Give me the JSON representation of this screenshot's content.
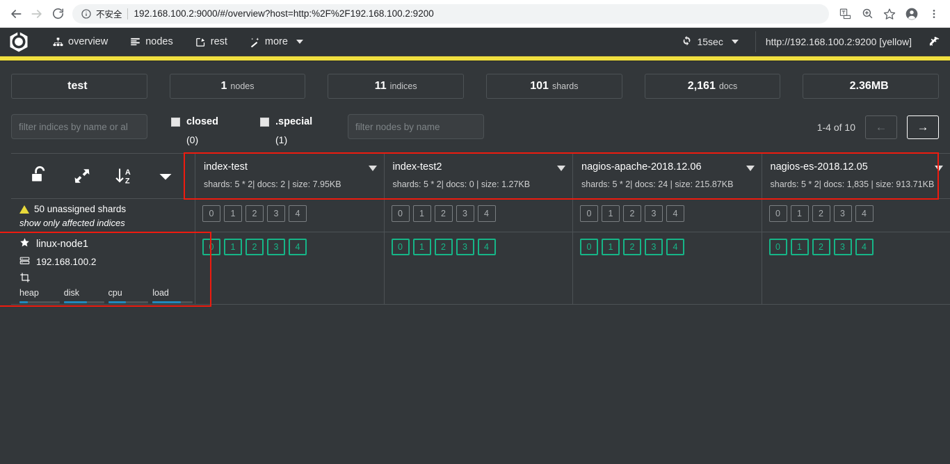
{
  "browser": {
    "back_icon": "back-arrow-icon",
    "forward_icon": "forward-arrow-icon",
    "reload_icon": "reload-icon",
    "security_label": "不安全",
    "url": "192.168.100.2:9000/#/overview?host=http:%2F%2F192.168.100.2:9200",
    "toolbar_icons": [
      "translate-icon",
      "zoom-icon",
      "bookmark-star-icon",
      "profile-avatar-icon",
      "chrome-menu-icon"
    ]
  },
  "app_header": {
    "logo": "cerebro-logo-icon",
    "nav": [
      {
        "label": "overview",
        "icon": "sitemap-icon"
      },
      {
        "label": "nodes",
        "icon": "list-icon"
      },
      {
        "label": "rest",
        "icon": "edit-square-icon"
      },
      {
        "label": "more",
        "icon": "magic-wand-icon",
        "has_caret": true
      }
    ],
    "refresh_interval": "15sec",
    "refresh_icon": "refresh-icon",
    "cluster_url": "http://192.168.100.2:9200 [yellow]",
    "disconnect_icon": "plug-icon",
    "accent_color": "#f0df3f"
  },
  "stats": [
    {
      "value": "test",
      "unit": ""
    },
    {
      "value": "1",
      "unit": "nodes"
    },
    {
      "value": "11",
      "unit": "indices"
    },
    {
      "value": "101",
      "unit": "shards"
    },
    {
      "value": "2,161",
      "unit": "docs"
    },
    {
      "value": "2.36MB",
      "unit": ""
    }
  ],
  "filters": {
    "indices_placeholder": "filter indices by name or al",
    "indices_value": "",
    "nodes_placeholder": "filter nodes by name",
    "nodes_value": "",
    "checkboxes": [
      {
        "label": "closed",
        "count": "(0)",
        "checked": false
      },
      {
        "label": ".special",
        "count": "(1)",
        "checked": false
      }
    ]
  },
  "pagination": {
    "range": "1-4 of 10",
    "prev_label": "←",
    "next_label": "→"
  },
  "table_toolbar": {
    "icons": [
      {
        "name": "unlock-icon"
      },
      {
        "name": "expand-arrows-icon"
      },
      {
        "name": "sort-az-icon"
      },
      {
        "name": "caret-down-icon"
      }
    ]
  },
  "indices": [
    {
      "name": "index-test",
      "meta": "shards: 5 * 2| docs: 2 | size: 7.95KB",
      "unassigned_shards": [
        "0",
        "1",
        "2",
        "3",
        "4"
      ],
      "node_shards": [
        "0",
        "1",
        "2",
        "3",
        "4"
      ]
    },
    {
      "name": "index-test2",
      "meta": "shards: 5 * 2| docs: 0 | size: 1.27KB",
      "unassigned_shards": [
        "0",
        "1",
        "2",
        "3",
        "4"
      ],
      "node_shards": [
        "0",
        "1",
        "2",
        "3",
        "4"
      ]
    },
    {
      "name": "nagios-apache-2018.12.06",
      "meta": "shards: 5 * 2| docs: 24 | size: 215.87KB",
      "unassigned_shards": [
        "0",
        "1",
        "2",
        "3",
        "4"
      ],
      "node_shards": [
        "0",
        "1",
        "2",
        "3",
        "4"
      ]
    },
    {
      "name": "nagios-es-2018.12.05",
      "meta": "shards: 5 * 2| docs: 1,835 | size: 913.71KB",
      "unassigned_shards": [
        "0",
        "1",
        "2",
        "3",
        "4"
      ],
      "node_shards": [
        "0",
        "1",
        "2",
        "3",
        "4"
      ]
    }
  ],
  "unassigned_row": {
    "title": "50 unassigned shards",
    "link": "show only affected indices",
    "warn_icon": "warning-triangle-icon"
  },
  "node_row": {
    "name": "linux-node1",
    "name_icon": "star-icon",
    "ip": "192.168.100.2",
    "ip_icon": "server-icon",
    "extra_icon": "cluster-node-icon",
    "gauges": [
      {
        "label": "heap",
        "percent": 20
      },
      {
        "label": "disk",
        "percent": 58
      },
      {
        "label": "cpu",
        "percent": 45
      },
      {
        "label": "load",
        "percent": 70
      }
    ]
  },
  "annotations": {
    "highlight_color": "#ee1b0f"
  }
}
